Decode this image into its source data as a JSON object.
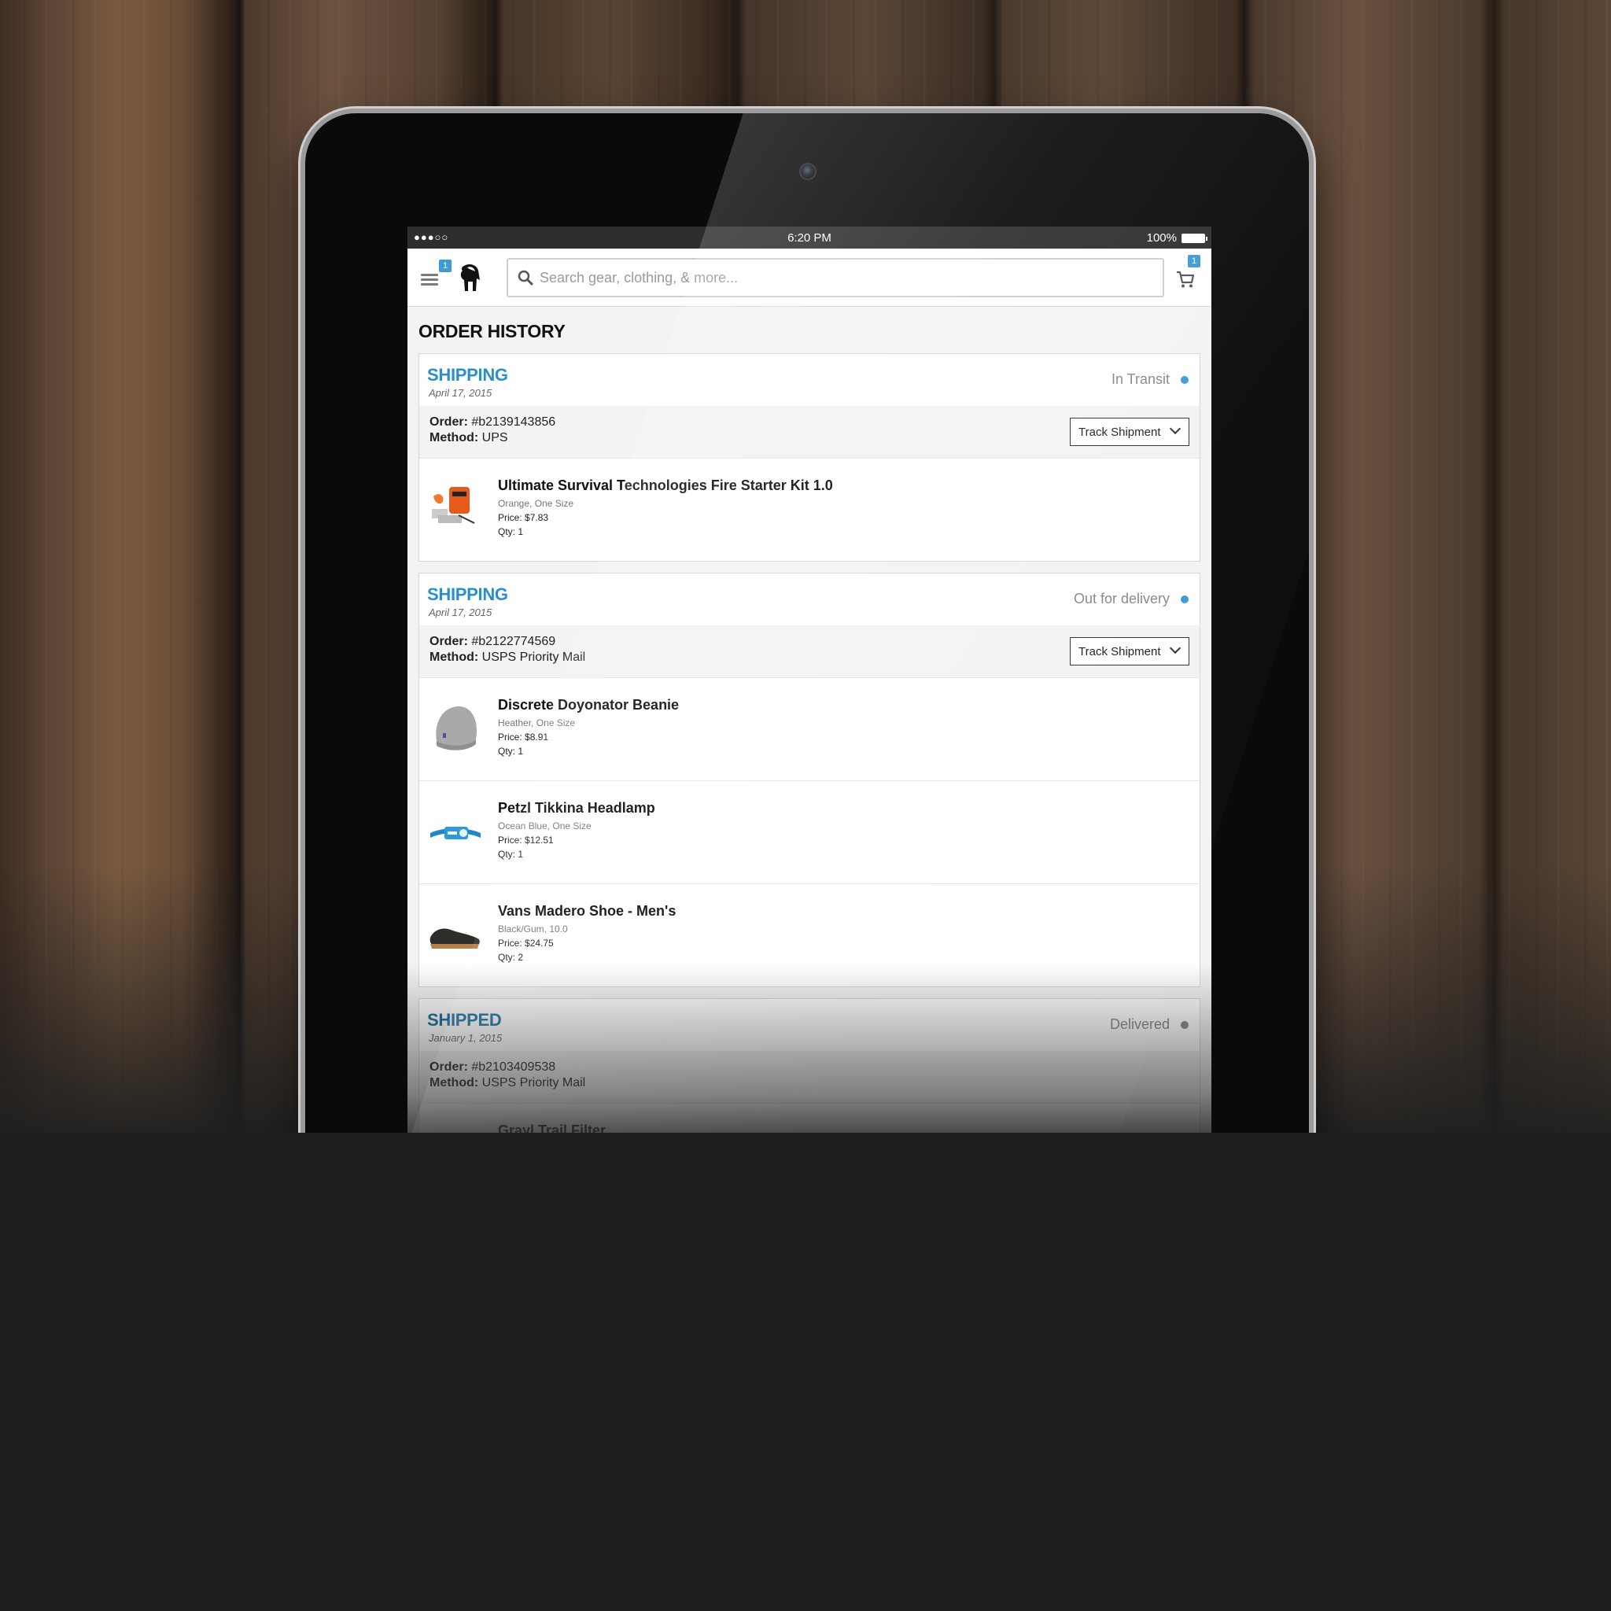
{
  "status_bar": {
    "signal": "●●●○○",
    "time": "6:20 PM",
    "battery": "100%"
  },
  "header": {
    "menu_badge": "1",
    "cart_badge": "1",
    "search_placeholder": "Search gear, clothing, & more...",
    "search_value": ""
  },
  "page": {
    "title": "ORDER HISTORY"
  },
  "labels": {
    "order": "Order:",
    "method": "Method:",
    "price": "Price:",
    "qty": "Qty:"
  },
  "colors": {
    "accent": "#2a90cc",
    "status_dot_active": "#3d9ad6",
    "status_dot_done": "#8a8a8a"
  },
  "orders": [
    {
      "state": "SHIPPING",
      "date": "April 17, 2015",
      "status": "In Transit",
      "order_number": "#b2139143856",
      "method": "UPS",
      "track_label": "Track Shipment",
      "items": [
        {
          "icon": "fire-starter-kit-image",
          "name": "Ultimate Survival Technologies Fire Starter Kit 1.0",
          "variant": "Orange, One Size",
          "price": "$7.83",
          "qty": "1"
        }
      ]
    },
    {
      "state": "SHIPPING",
      "date": "April 17, 2015",
      "status": "Out for delivery",
      "order_number": "#b2122774569",
      "method": "USPS Priority Mail",
      "track_label": "Track Shipment",
      "items": [
        {
          "icon": "beanie-image",
          "name": "Discrete Doyonator Beanie",
          "variant": "Heather, One Size",
          "price": "$8.91",
          "qty": "1"
        },
        {
          "icon": "headlamp-image",
          "name": "Petzl Tikkina Headlamp",
          "variant": "Ocean Blue, One Size",
          "price": "$12.51",
          "qty": "1"
        },
        {
          "icon": "shoe-image",
          "name": "Vans Madero Shoe - Men's",
          "variant": "Black/Gum, 10.0",
          "price": "$24.75",
          "qty": "2"
        }
      ]
    },
    {
      "state": "SHIPPED",
      "date": "January 1, 2015",
      "status": "Delivered",
      "order_number": "#b2103409538",
      "method": "USPS Priority Mail",
      "items": [
        {
          "icon": "water-filter-image",
          "name": "Grayl Trail Filter"
        }
      ]
    }
  ]
}
